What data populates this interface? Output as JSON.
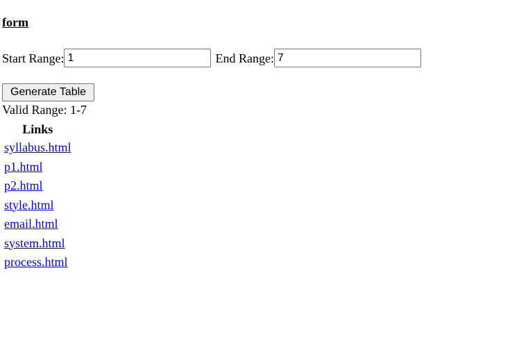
{
  "form": {
    "heading": "form",
    "start_label": "Start Range:",
    "start_value": "1",
    "end_label": "End Range:",
    "end_value": "7",
    "generate_label": "Generate Table",
    "valid_range_text": "Valid Range: 1-7"
  },
  "links_table": {
    "header": "Links",
    "rows": [
      {
        "label": "syllabus.html"
      },
      {
        "label": "p1.html"
      },
      {
        "label": "p2.html"
      },
      {
        "label": "style.html"
      },
      {
        "label": "email.html"
      },
      {
        "label": "system.html"
      },
      {
        "label": "process.html"
      }
    ]
  },
  "colors": {
    "link": "#0000ee",
    "text": "#000000",
    "background": "#ffffff"
  }
}
